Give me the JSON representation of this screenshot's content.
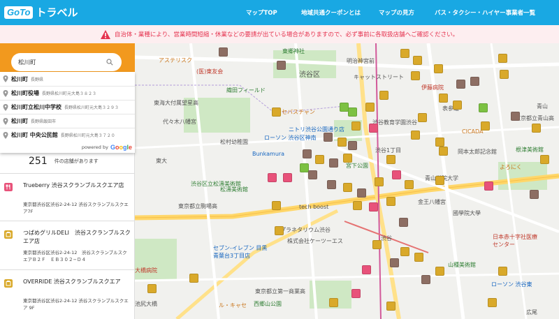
{
  "header": {
    "logo_box": "GoTo",
    "logo_text": "トラベル",
    "nav": [
      "マップTOP",
      "地域共通クーポンとは",
      "マップの見方",
      "バス・タクシー・ハイヤー事業者一覧"
    ]
  },
  "alert": {
    "text": "自治体・業種により、営業時間短縮・休業などの要請が出ている場合がありますので、必ず事前に各取扱店舗へご確認ください。"
  },
  "search": {
    "value": "松川町",
    "icon": "search-icon"
  },
  "suggestions": [
    {
      "main": "松川町",
      "sub": "長野県"
    },
    {
      "main": "松川町役場",
      "sub": "長野県松川町元大島３８２３"
    },
    {
      "main": "松川町立松川中学校",
      "sub": "長野県松川町元大島３２９３"
    },
    {
      "main": "松川町",
      "sub": "長野県飯田市"
    },
    {
      "main": "松川町 中央公民館",
      "sub": "長野県松川町元大島３７２０"
    }
  ],
  "powered_by": {
    "text": "powered by",
    "brand": "Google"
  },
  "result": {
    "count": "251",
    "label": "件の店舗があります"
  },
  "stores": [
    {
      "title": "Trueberry 渋谷スクランブルスクエア店",
      "address": "東京都渋谷区渋谷2-24-12 渋谷スクランブルスクエア7F",
      "type": "restaurant"
    },
    {
      "title": "つばめグリルDELI　渋谷スクランブルスクエア店",
      "address": "東京都渋谷区渋谷2-24-12　渋谷スクランブルスクエアＢ２Ｆ　ＥＢ３０２−Ｄ４",
      "type": "shop"
    },
    {
      "title": "OVERRIDE 渋谷スクランブルスクエア",
      "address": "東京都渋谷区渋谷2-24-12 渋谷スクランブルスクエア 9F",
      "type": "shop"
    }
  ],
  "map_labels": [
    {
      "text": "アステリスク",
      "color": "#c9751b"
    },
    {
      "text": "(医)東友会",
      "color": "#c0392b"
    },
    {
      "text": "渋谷区",
      "color": "#555"
    },
    {
      "text": "明治神宮前",
      "color": "#555"
    },
    {
      "text": "キャットストリート",
      "color": "#555"
    },
    {
      "text": "伊藤病院",
      "color": "#c0392b"
    },
    {
      "text": "表参道",
      "color": "#555"
    },
    {
      "text": "東郷神社",
      "color": "#2e7d32"
    },
    {
      "text": "織田フィールド",
      "color": "#2e7d32"
    },
    {
      "text": "東海大付属望星高",
      "color": "#555"
    },
    {
      "text": "代々木八幡宮",
      "color": "#555"
    },
    {
      "text": "セバスチャン",
      "color": "#c9751b"
    },
    {
      "text": "渋谷教育学園渋谷",
      "color": "#555"
    },
    {
      "text": "CICADA",
      "color": "#c9751b"
    },
    {
      "text": "松村幼稚園",
      "color": "#555"
    },
    {
      "text": "ニトリ渋谷公園通り店",
      "color": "#1565c0"
    },
    {
      "text": "ローソン 渋谷区神南",
      "color": "#1565c0"
    },
    {
      "text": "東京都立青山高",
      "color": "#555"
    },
    {
      "text": "根津美術館",
      "color": "#2e7d32"
    },
    {
      "text": "Bunkamura",
      "color": "#1565c0"
    },
    {
      "text": "渋谷1丁目",
      "color": "#555"
    },
    {
      "text": "岡本太郎記念館",
      "color": "#555"
    },
    {
      "text": "青山学院大学",
      "color": "#555"
    },
    {
      "text": "よろにく",
      "color": "#c9751b"
    },
    {
      "text": "松濤美術館",
      "color": "#2e7d32"
    },
    {
      "text": "渋谷区立松濤美術館",
      "color": "#2e7d32"
    },
    {
      "text": "tech boost",
      "color": "#555"
    },
    {
      "text": "宮下公園",
      "color": "#2e7d32"
    },
    {
      "text": "金王八幡宮",
      "color": "#555"
    },
    {
      "text": "國學院大學",
      "color": "#555"
    },
    {
      "text": "東京都立駒場高",
      "color": "#555"
    },
    {
      "text": "プラネタリウム渋谷",
      "color": "#555"
    },
    {
      "text": "株式会社ケーツーエス",
      "color": "#555"
    },
    {
      "text": "渋谷",
      "color": "#555"
    },
    {
      "text": "日本赤十字社医療センター",
      "color": "#c0392b"
    },
    {
      "text": "山種美術館",
      "color": "#2e7d32"
    },
    {
      "text": "セブン-イレブン 目黒青葉台3丁目店",
      "color": "#1565c0"
    },
    {
      "text": "東京都立第一商業高",
      "color": "#555"
    },
    {
      "text": "西郷山公園",
      "color": "#2e7d32"
    },
    {
      "text": "ローソン 渋谷東",
      "color": "#1565c0"
    },
    {
      "text": "大橋病院",
      "color": "#c0392b"
    },
    {
      "text": "池尻大橋",
      "color": "#555"
    },
    {
      "text": "ル・キャセ",
      "color": "#c9751b"
    },
    {
      "text": "広尾",
      "color": "#555"
    },
    {
      "text": "東大",
      "color": "#555"
    },
    {
      "text": "青山",
      "color": "#555"
    }
  ],
  "colors": {
    "header": "#19a8e3",
    "alert_bg": "#fdeef0",
    "alert_text": "#e5334f",
    "search_bg": "#f2991e",
    "marker_shop": "#d9a92a",
    "marker_restaurant": "#e8527a",
    "marker_hotel": "#8d6e63",
    "marker_leisure": "#7cc142"
  }
}
